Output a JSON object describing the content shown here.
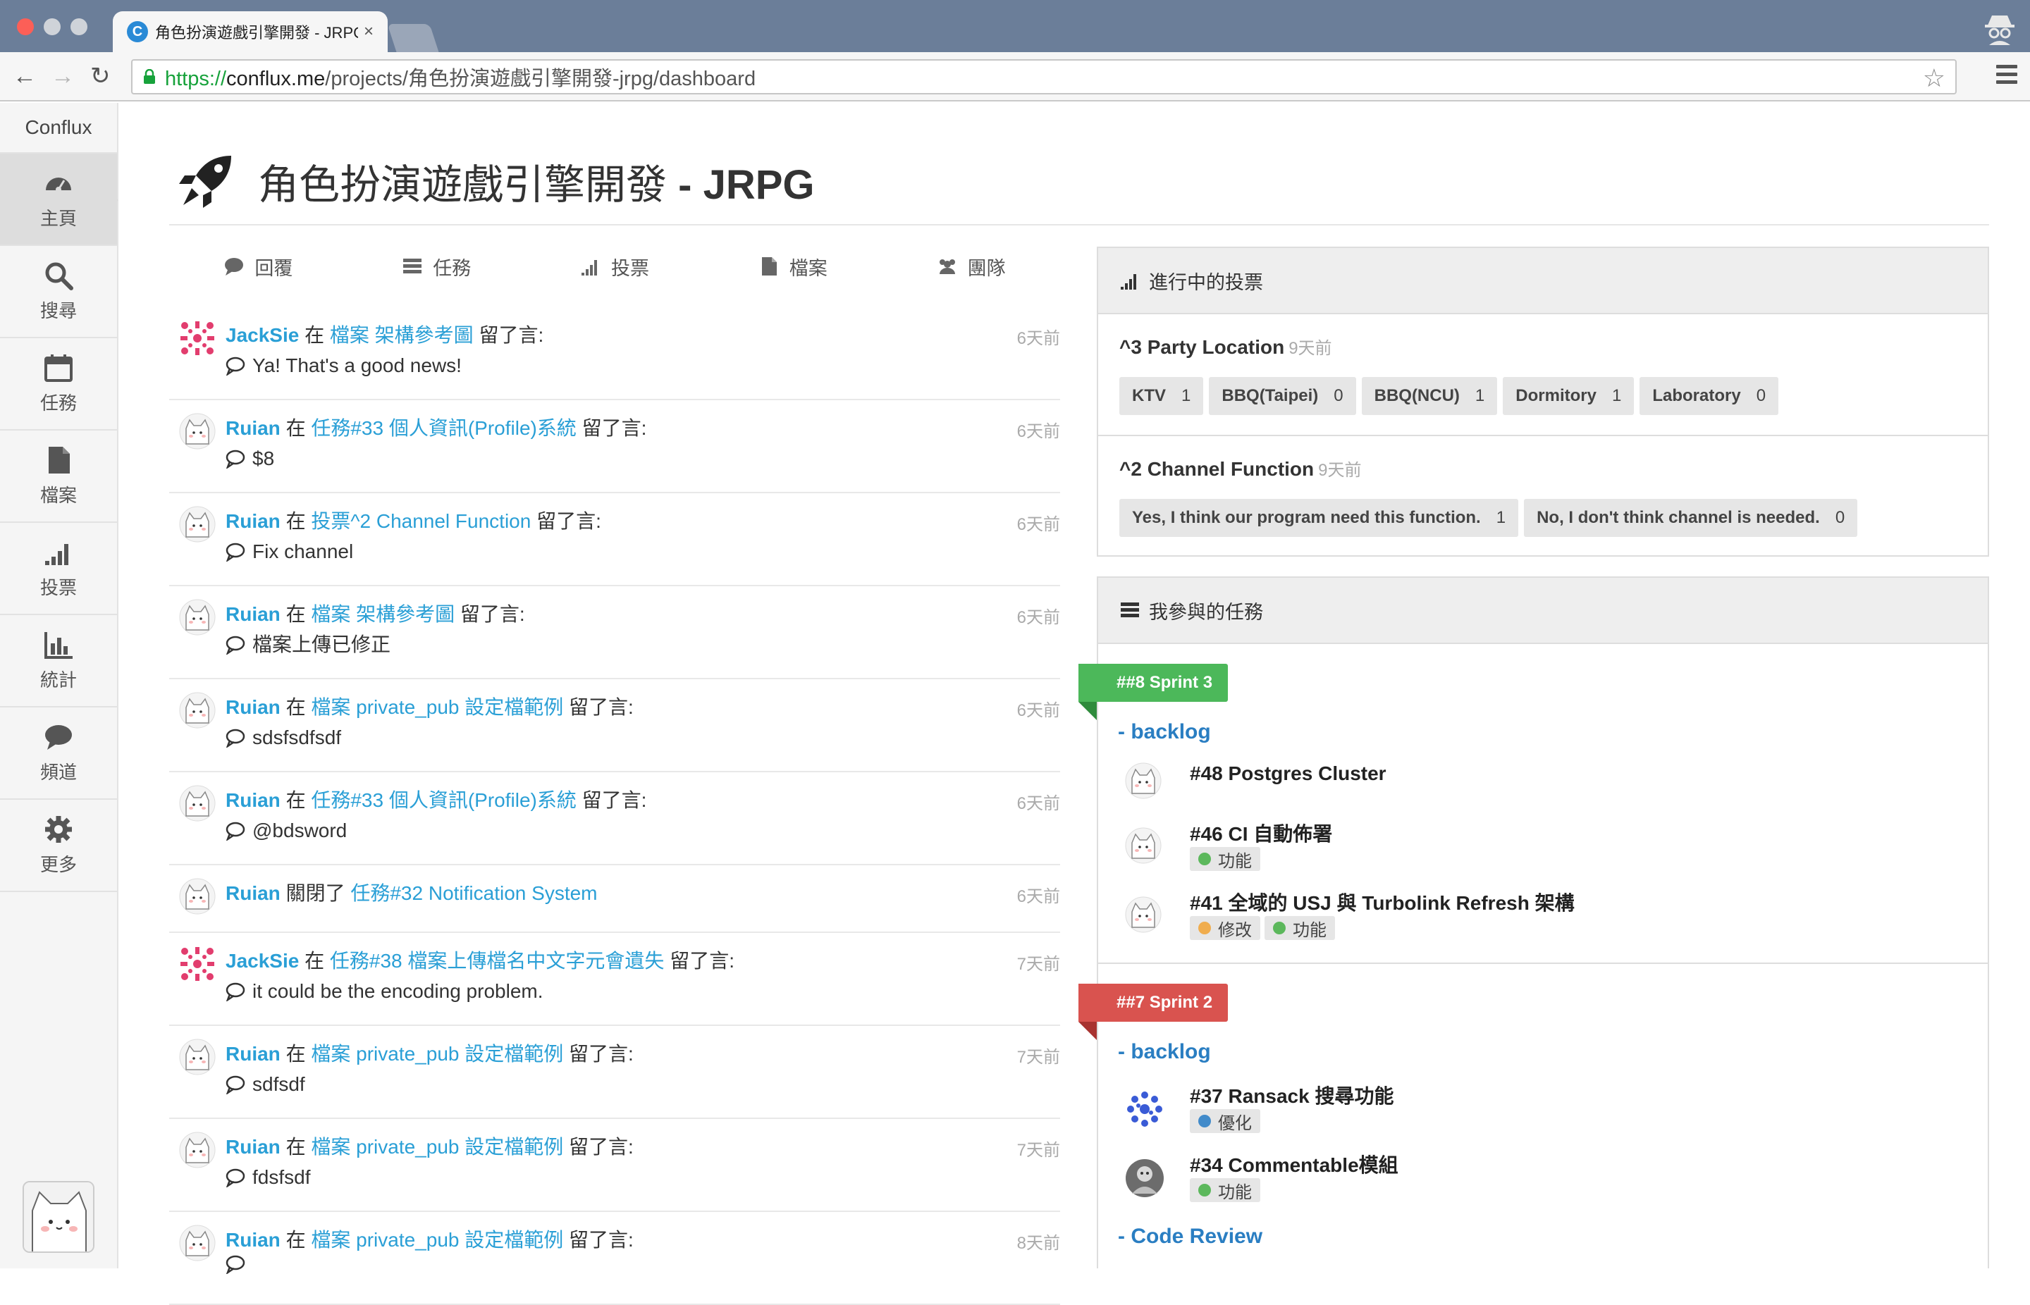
{
  "browser": {
    "tab_title": "角色扮演遊戲引擎開發 - JRPG",
    "favicon_letter": "C",
    "url_scheme": "https://",
    "url_host": "conflux.me",
    "url_path": "/projects/角色扮演遊戲引擎開發-jrpg/dashboard"
  },
  "sidebar": {
    "brand": "Conflux",
    "items": [
      {
        "label": "主頁",
        "icon": "dashboard-icon"
      },
      {
        "label": "搜尋",
        "icon": "search-icon"
      },
      {
        "label": "任務",
        "icon": "calendar-icon"
      },
      {
        "label": "檔案",
        "icon": "file-icon"
      },
      {
        "label": "投票",
        "icon": "signal-icon"
      },
      {
        "label": "統計",
        "icon": "bar-chart-icon"
      },
      {
        "label": "頻道",
        "icon": "chat-icon"
      },
      {
        "label": "更多",
        "icon": "gear-icon"
      }
    ]
  },
  "header": {
    "title_cjk": "角色扮演遊戲引擎開發",
    "title_sep": " - ",
    "title_code": "JRPG"
  },
  "feed_tabs": [
    "回覆",
    "任務",
    "投票",
    "檔案",
    "團隊"
  ],
  "feed": [
    {
      "user": "JackSie",
      "pre": "在",
      "target": "檔案 架構參考圖",
      "post": "留了言:",
      "comment": "Ya! That's a good news!",
      "time": "6天前",
      "avatar": "pattern-avatar"
    },
    {
      "user": "Ruian",
      "pre": "在",
      "target": "任務#33 個人資訊(Profile)系統",
      "post": "留了言:",
      "comment": "$8",
      "time": "6天前",
      "avatar": "cat-avatar"
    },
    {
      "user": "Ruian",
      "pre": "在",
      "target": "投票^2 Channel Function",
      "post": "留了言:",
      "comment": "Fix channel",
      "time": "6天前",
      "avatar": "cat-avatar"
    },
    {
      "user": "Ruian",
      "pre": "在",
      "target": "檔案 架構參考圖",
      "post": "留了言:",
      "comment": "檔案上傳已修正",
      "time": "6天前",
      "avatar": "cat-avatar"
    },
    {
      "user": "Ruian",
      "pre": "在",
      "target": "檔案 private_pub 設定檔範例",
      "post": "留了言:",
      "comment": "sdsfsdfsdf",
      "time": "6天前",
      "avatar": "cat-avatar"
    },
    {
      "user": "Ruian",
      "pre": "在",
      "target": "任務#33 個人資訊(Profile)系統",
      "post": "留了言:",
      "comment": "@bdsword",
      "time": "6天前",
      "avatar": "cat-avatar"
    },
    {
      "user": "Ruian",
      "pre": "關閉了",
      "target": "任務#32 Notification System",
      "post": "",
      "comment": "",
      "time": "6天前",
      "avatar": "cat-avatar"
    },
    {
      "user": "JackSie",
      "pre": "在",
      "target": "任務#38 檔案上傳檔名中文字元會遺失",
      "post": "留了言:",
      "comment": "it could be the encoding problem.",
      "time": "7天前",
      "avatar": "pattern-avatar"
    },
    {
      "user": "Ruian",
      "pre": "在",
      "target": "檔案 private_pub 設定檔範例",
      "post": "留了言:",
      "comment": "sdfsdf",
      "time": "7天前",
      "avatar": "cat-avatar"
    },
    {
      "user": "Ruian",
      "pre": "在",
      "target": "檔案 private_pub 設定檔範例",
      "post": "留了言:",
      "comment": "fdsfsdf",
      "time": "7天前",
      "avatar": "cat-avatar"
    },
    {
      "user": "Ruian",
      "pre": "在",
      "target": "檔案 private_pub 設定檔範例",
      "post": "留了言:",
      "comment": "",
      "time": "8天前",
      "avatar": "cat-avatar"
    }
  ],
  "polls_panel": {
    "heading": "進行中的投票",
    "polls": [
      {
        "title": "^3 Party Location",
        "time": "9天前",
        "options": [
          {
            "label": "KTV",
            "count": "1"
          },
          {
            "label": "BBQ(Taipei)",
            "count": "0"
          },
          {
            "label": "BBQ(NCU)",
            "count": "1"
          },
          {
            "label": "Dormitory",
            "count": "1"
          },
          {
            "label": "Laboratory",
            "count": "0"
          }
        ]
      },
      {
        "title": "^2 Channel Function",
        "time": "9天前",
        "options": [
          {
            "label": "Yes, I think our program need this function.",
            "count": "1"
          },
          {
            "label": "No, I don't think channel is needed.",
            "count": "0"
          }
        ]
      }
    ]
  },
  "tasks_panel": {
    "heading": "我參與的任務",
    "sprints": [
      {
        "name": "##8 Sprint 3",
        "color": "#4cb85a",
        "groups": [
          {
            "title": "- backlog",
            "tasks": [
              {
                "title": "#48 Postgres Cluster",
                "tags": []
              },
              {
                "title": "#46 CI 自動佈署",
                "tags": [
                  {
                    "label": "功能",
                    "color": "#5cb85c"
                  }
                ]
              },
              {
                "title": "#41 全域的 USJ 與 Turbolink Refresh 架構",
                "tags": [
                  {
                    "label": "修改",
                    "color": "#f0ad4e"
                  },
                  {
                    "label": "功能",
                    "color": "#5cb85c"
                  }
                ]
              }
            ]
          }
        ]
      },
      {
        "name": "##7 Sprint 2",
        "color": "#d9534f",
        "groups": [
          {
            "title": "- backlog",
            "tasks": [
              {
                "title": "#37 Ransack 搜尋功能",
                "tags": [
                  {
                    "label": "優化",
                    "color": "#428bca"
                  }
                ]
              },
              {
                "title": "#34 Commentable模組",
                "tags": [
                  {
                    "label": "功能",
                    "color": "#5cb85c"
                  }
                ]
              }
            ]
          },
          {
            "title": "- Code Review",
            "tasks": []
          }
        ]
      }
    ]
  }
}
